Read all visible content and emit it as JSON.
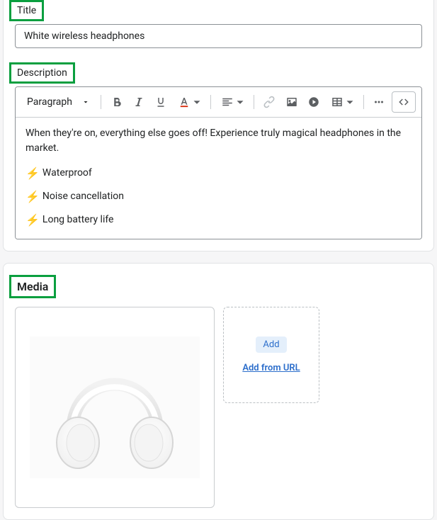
{
  "title": {
    "label": "Title",
    "value": "White wireless headphones"
  },
  "description": {
    "label": "Description",
    "toolbar": {
      "paragraph": "Paragraph"
    },
    "body": {
      "intro": "When they're on, everything else goes off! Experience truly magical headphones in the market.",
      "features": [
        "Waterproof",
        "Noise cancellation",
        " Long battery life"
      ]
    }
  },
  "media": {
    "label": "Media",
    "add_label": "Add",
    "add_url_label": "Add from URL",
    "thumb_alt": "White wireless headphones product image"
  }
}
